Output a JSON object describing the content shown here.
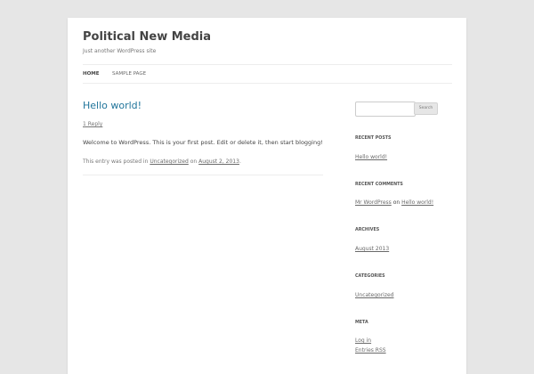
{
  "site": {
    "title": "Political New Media",
    "description": "Just another WordPress site"
  },
  "nav": {
    "items": [
      "HOME",
      "SAMPLE PAGE"
    ]
  },
  "post": {
    "title": "Hello world!",
    "reply": "1 Reply",
    "content": "Welcome to WordPress. This is your first post. Edit or delete it, then start blogging!",
    "meta_prefix": "This entry was posted in",
    "category": "Uncategorized",
    "on": "on",
    "date": "August 2, 2013",
    "period": "."
  },
  "sidebar": {
    "search_button": "Search",
    "search_placeholder": "",
    "recent_posts": {
      "title": "RECENT POSTS",
      "items": [
        "Hello world!"
      ]
    },
    "recent_comments": {
      "title": "RECENT COMMENTS",
      "author": "Mr WordPress",
      "on": "on",
      "post": "Hello world!"
    },
    "archives": {
      "title": "ARCHIVES",
      "items": [
        "August 2013"
      ]
    },
    "categories": {
      "title": "CATEGORIES",
      "items": [
        "Uncategorized"
      ]
    },
    "meta": {
      "title": "META",
      "items": [
        "Log in",
        "Entries RSS"
      ]
    }
  }
}
